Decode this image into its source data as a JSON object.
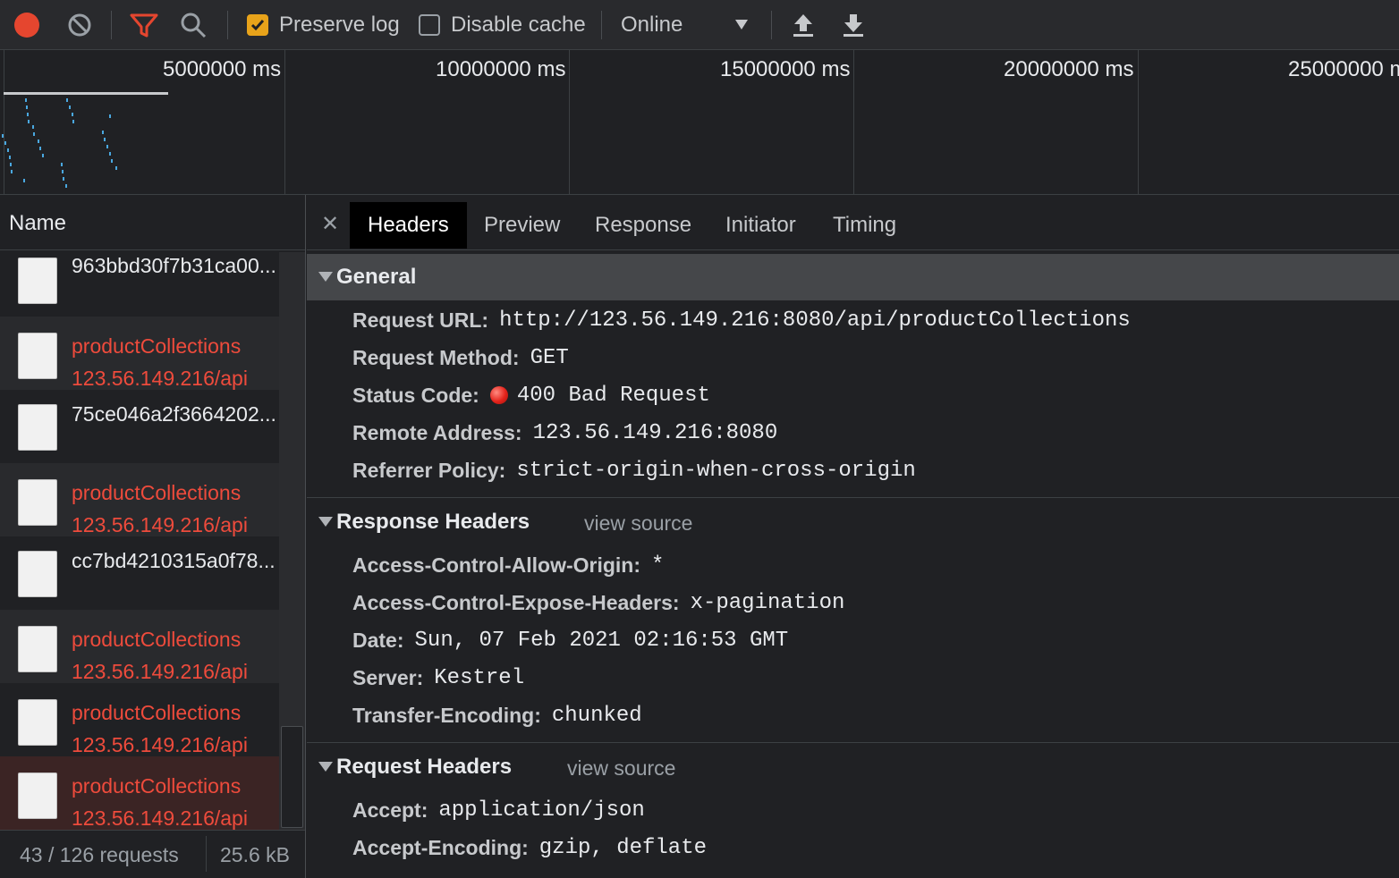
{
  "toolbar": {
    "preserve_log_label": "Preserve log",
    "preserve_log_checked": true,
    "disable_cache_label": "Disable cache",
    "disable_cache_checked": false,
    "throttling_value": "Online",
    "icons": [
      "record-icon",
      "clear-icon",
      "filter-icon",
      "search-icon",
      "upload-icon",
      "download-icon"
    ],
    "record_color": "#e5462f",
    "filter_color": "#e5462f"
  },
  "overview": {
    "ticks": [
      "5000000 ms",
      "10000000 ms",
      "15000000 ms",
      "20000000 ms",
      "25000000 ms"
    ]
  },
  "request_list": {
    "header": "Name",
    "rows": [
      {
        "name": "963bbd30f7b31ca00...",
        "domain": "",
        "error": false
      },
      {
        "name": "productCollections",
        "domain": "123.56.149.216/api",
        "error": true
      },
      {
        "name": "75ce046a2f3664202...",
        "domain": "",
        "error": false
      },
      {
        "name": "productCollections",
        "domain": "123.56.149.216/api",
        "error": true
      },
      {
        "name": "cc7bd4210315a0f78...",
        "domain": "",
        "error": false
      },
      {
        "name": "productCollections",
        "domain": "123.56.149.216/api",
        "error": true
      },
      {
        "name": "productCollections",
        "domain": "123.56.149.216/api",
        "error": true
      },
      {
        "name": "productCollections",
        "domain": "123.56.149.216/api",
        "error": true,
        "selected": true
      }
    ],
    "requests_count": "43 / 126 requests",
    "transferred": "25.6 kB"
  },
  "details": {
    "tabs": [
      "Headers",
      "Preview",
      "Response",
      "Initiator",
      "Timing"
    ],
    "active_tab": "Headers",
    "general": {
      "title": "General",
      "items": [
        {
          "key": "Request URL:",
          "value": "http://123.56.149.216:8080/api/productCollections"
        },
        {
          "key": "Request Method:",
          "value": "GET"
        },
        {
          "key": "Status Code:",
          "value": "400 Bad Request"
        },
        {
          "key": "Remote Address:",
          "value": "123.56.149.216:8080"
        },
        {
          "key": "Referrer Policy:",
          "value": "strict-origin-when-cross-origin"
        }
      ]
    },
    "response_headers": {
      "title": "Response Headers",
      "view_source": "view source",
      "items": [
        {
          "key": "Access-Control-Allow-Origin:",
          "value": "*"
        },
        {
          "key": "Access-Control-Expose-Headers:",
          "value": "x-pagination"
        },
        {
          "key": "Date:",
          "value": "Sun, 07 Feb 2021 02:16:53 GMT"
        },
        {
          "key": "Server:",
          "value": "Kestrel"
        },
        {
          "key": "Transfer-Encoding:",
          "value": "chunked"
        }
      ]
    },
    "request_headers": {
      "title": "Request Headers",
      "view_source": "view source",
      "items": [
        {
          "key": "Accept:",
          "value": "application/json"
        },
        {
          "key": "Accept-Encoding:",
          "value": "gzip, deflate"
        }
      ]
    },
    "status_color": "#e5231b",
    "error_text_color": "#ee4b3c"
  }
}
